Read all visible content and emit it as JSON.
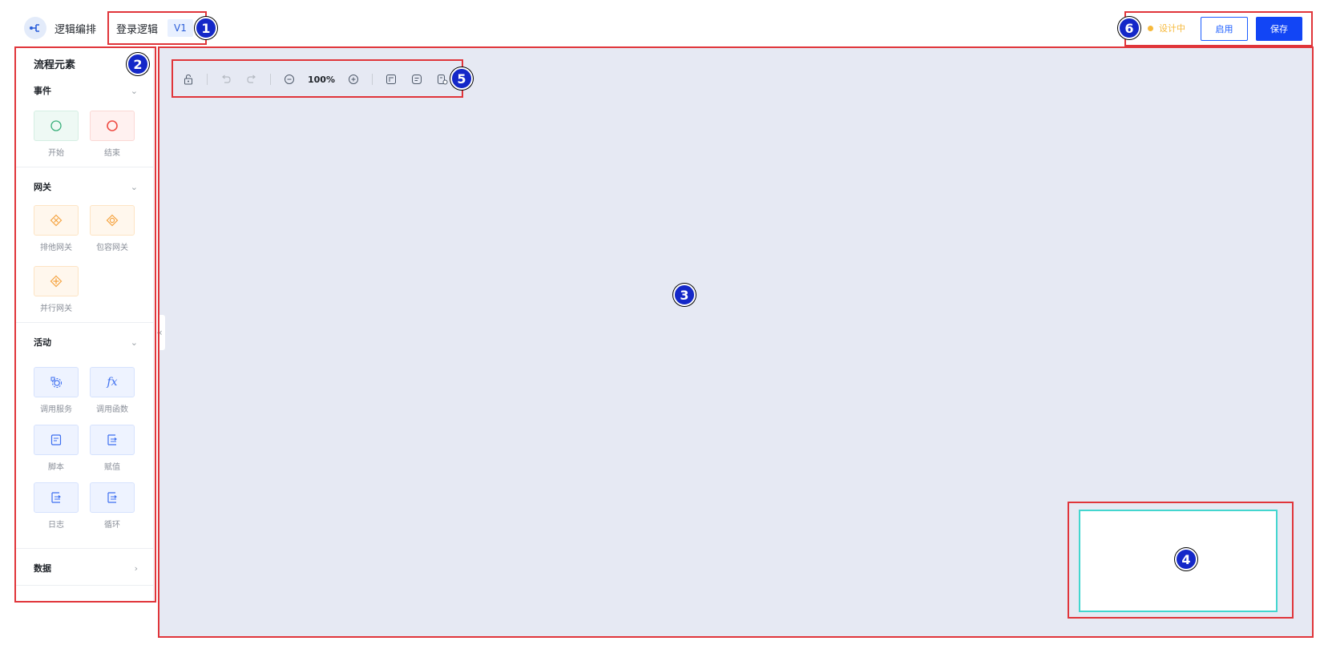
{
  "header": {
    "app_title": "逻辑编排",
    "logic_name": "登录逻辑",
    "version": "V1",
    "status_text": "设计中",
    "enable_label": "启用",
    "save_label": "保存"
  },
  "sidebar": {
    "title": "流程元素",
    "sections": [
      {
        "label": "事件",
        "chevron": "⌄",
        "items": [
          {
            "label": "开始",
            "icon": "circle-green-icon"
          },
          {
            "label": "结束",
            "icon": "circle-red-icon"
          }
        ]
      },
      {
        "label": "网关",
        "chevron": "⌄",
        "items": [
          {
            "label": "排他网关",
            "icon": "exclusive-gateway-icon"
          },
          {
            "label": "包容网关",
            "icon": "inclusive-gateway-icon"
          },
          {
            "label": "并行网关",
            "icon": "parallel-gateway-icon"
          }
        ]
      },
      {
        "label": "活动",
        "chevron": "⌄",
        "items": [
          {
            "label": "调用服务",
            "icon": "service-icon"
          },
          {
            "label": "调用函数",
            "icon": "function-icon",
            "glyph": "fx"
          },
          {
            "label": "脚本",
            "icon": "script-icon"
          },
          {
            "label": "赋值",
            "icon": "assign-icon"
          },
          {
            "label": "日志",
            "icon": "log-icon"
          },
          {
            "label": "循环",
            "icon": "loop-icon"
          }
        ]
      },
      {
        "label": "数据",
        "chevron": "›",
        "items": []
      }
    ]
  },
  "toolbar": {
    "zoom": "100%"
  },
  "collapse_glyph": "«",
  "markers": [
    "1",
    "2",
    "3",
    "4",
    "5",
    "6"
  ],
  "colors": {
    "primary": "#1245f5",
    "status": "#f6b93b",
    "canvas": "#e6e9f3",
    "minimap_border": "#43d6cf",
    "annotation": "#e0353a"
  }
}
